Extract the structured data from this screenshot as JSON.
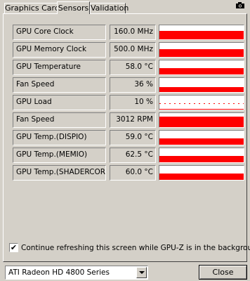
{
  "tabs": [
    {
      "label": "Graphics Card",
      "active": false
    },
    {
      "label": "Sensors",
      "active": true
    },
    {
      "label": "Validation",
      "active": false
    }
  ],
  "toolbar": {
    "screenshot_icon": "camera-icon"
  },
  "sensors": [
    {
      "name": "GPU Core Clock",
      "value": "160.0 MHz",
      "graph_level": 0.6
    },
    {
      "name": "GPU Memory Clock",
      "value": "500.0 MHz",
      "graph_level": 0.55
    },
    {
      "name": "GPU Temperature",
      "value": "58.0 °C",
      "graph_level": 0.45
    },
    {
      "name": "Fan Speed",
      "value": "36 %",
      "graph_level": 0.35
    },
    {
      "name": "GPU Load",
      "value": "10 %",
      "graph_level": 0.05
    },
    {
      "name": "Fan Speed",
      "value": "3012 RPM",
      "graph_level": 0.75
    },
    {
      "name": "GPU Temp.(DISPIO)",
      "value": "59.0 °C",
      "graph_level": 0.45
    },
    {
      "name": "GPU Temp.(MEMIO)",
      "value": "62.5 °C",
      "graph_level": 0.45
    },
    {
      "name": "GPU Temp.(SHADERCORE)",
      "value": "60.0 °C",
      "graph_level": 0.45
    }
  ],
  "refresh": {
    "checked": true,
    "check_mark": "✔",
    "label": "Continue refreshing this screen while GPU-Z is in the background"
  },
  "gpu_select": {
    "value": "ATI Radeon HD 4800 Series"
  },
  "close_label": "Close",
  "colors": {
    "graph": "#ff0000",
    "background": "#d4d0c8"
  }
}
